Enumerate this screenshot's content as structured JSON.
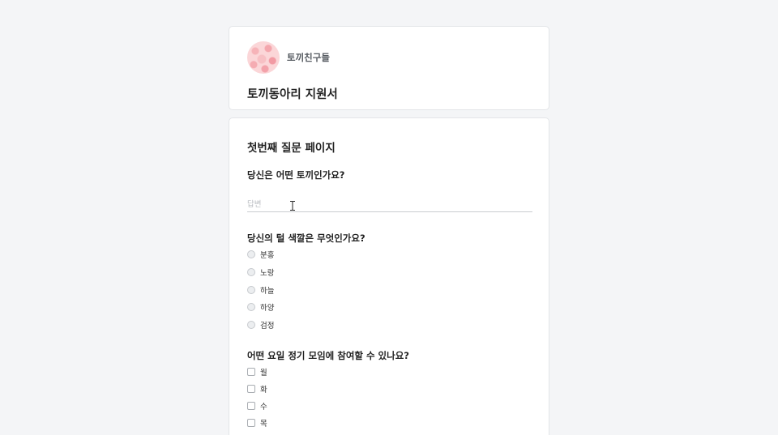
{
  "header": {
    "org_name": "토끼친구들",
    "form_title": "토끼동아리 지원서",
    "avatar_icon": "pink-rabbit-pattern-avatar"
  },
  "section": {
    "title": "첫번째 질문 페이지"
  },
  "questions": [
    {
      "label": "당신은 어떤 토끼인가요?",
      "type": "short-text",
      "placeholder": "답변",
      "value": ""
    },
    {
      "label": "당신의 털 색깔은 무엇인가요?",
      "type": "radio",
      "options": [
        "분홍",
        "노랑",
        "하늘",
        "하양",
        "검정"
      ]
    },
    {
      "label": "어떤 요일 정기 모임에 참여할 수 있나요?",
      "type": "checkbox",
      "options": [
        "월",
        "화",
        "수",
        "목"
      ]
    }
  ],
  "colors": {
    "background": "#f4f5f7",
    "card": "#ffffff",
    "border": "#e3e5e8",
    "radio_border": "#c6c9cd"
  }
}
